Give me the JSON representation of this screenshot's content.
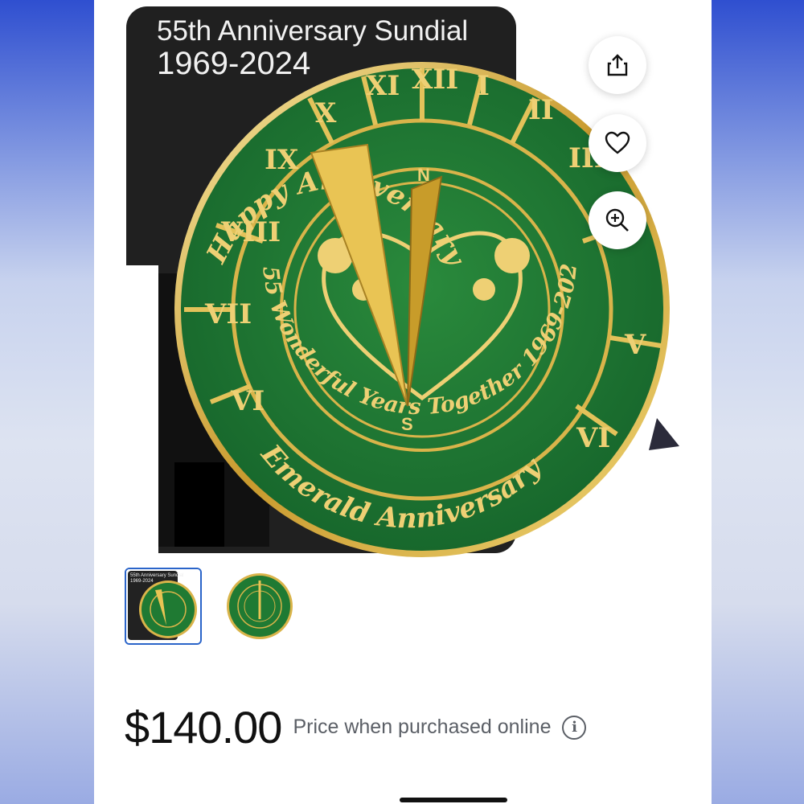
{
  "product": {
    "image_banner": {
      "title_line1": "55th Anniversary Sundial",
      "title_line2": "1969-2024"
    },
    "sundial_text": {
      "top_arc": "Happy Anniversary",
      "inner_arc": "55 Wonderful Years Together 1969-2024",
      "bottom_arc": "Emerald Anniversary",
      "north": "N",
      "south": "S",
      "numerals": [
        "V",
        "VI",
        "VII",
        "VIII",
        "IX",
        "X",
        "XI",
        "XII",
        "I",
        "II",
        "III",
        "IV",
        "V",
        "VI",
        "VII"
      ]
    },
    "actions": {
      "share_icon": "share-icon",
      "favorite_icon": "heart-icon",
      "zoom_icon": "zoom-in-icon"
    },
    "thumbnails": [
      {
        "name": "thumbnail-1",
        "selected": true,
        "title_line1": "55th Anniversary Sundial",
        "title_line2": "1969-2024"
      },
      {
        "name": "thumbnail-2",
        "selected": false
      }
    ],
    "price": "$140.00",
    "price_note": "Price when purchased online",
    "info_icon": "info-icon",
    "colors": {
      "emerald": "#1f7a33",
      "brass": "#d9b44a",
      "accent_blue": "#2a64c9"
    }
  }
}
